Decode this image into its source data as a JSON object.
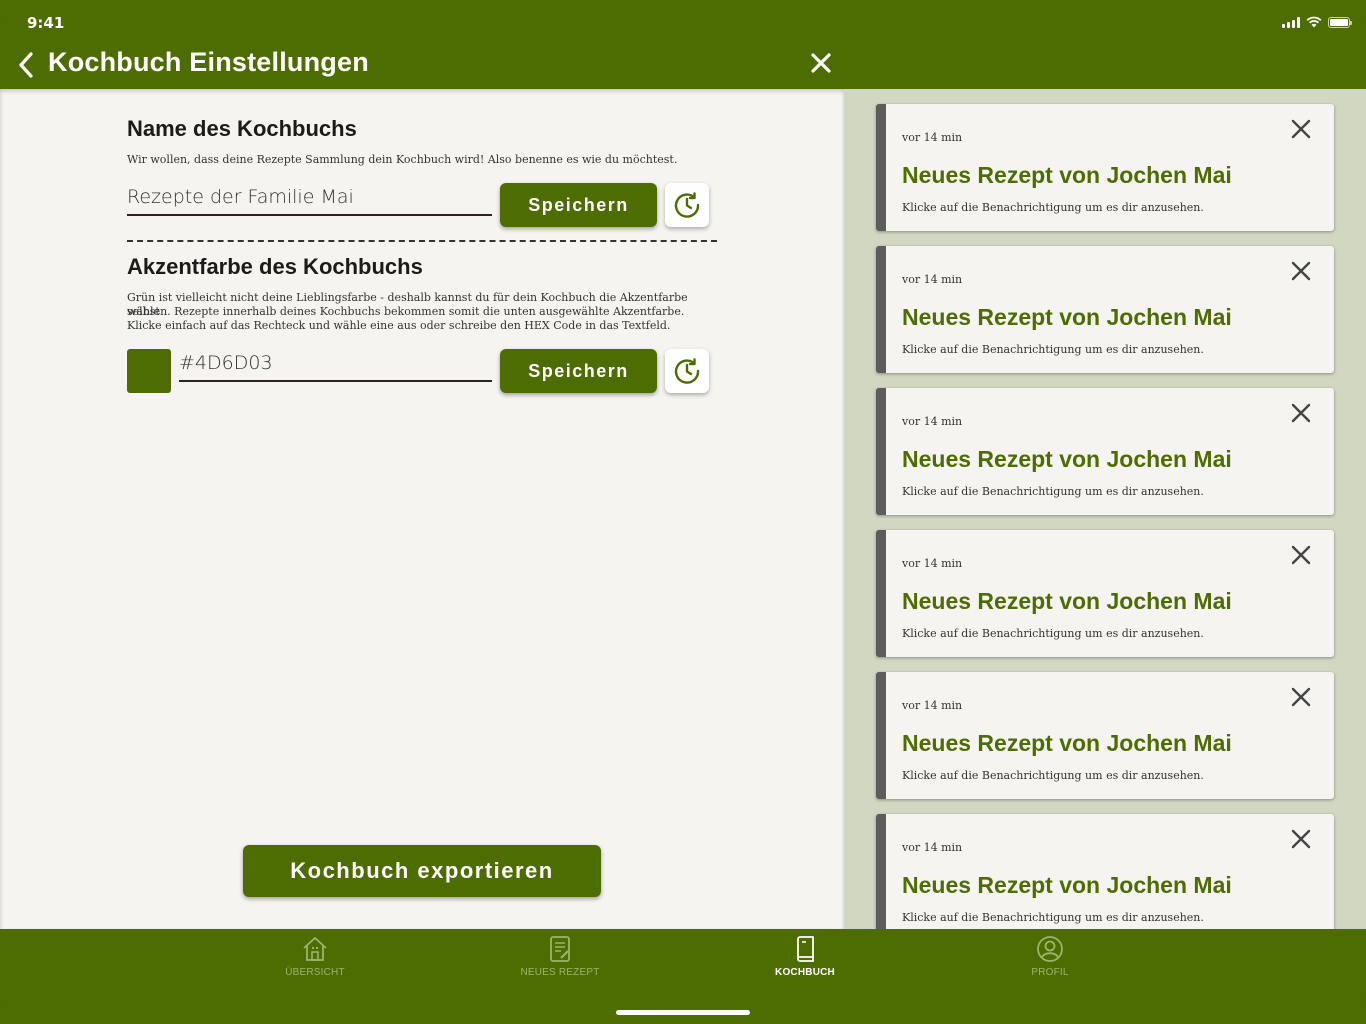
{
  "colors": {
    "accent": "#4D6D03",
    "panel_bg": "#F5F4F0",
    "notif_bg": "#D2D7C2",
    "swatch": "#4D6D03"
  },
  "status_bar": {
    "time": "9:41"
  },
  "header": {
    "title": "Kochbuch Einstellungen"
  },
  "name_section": {
    "heading": "Name des Kochbuchs",
    "description": "Wir wollen, dass deine Rezepte Sammlung dein Kochbuch wird! Also benenne es wie du möchtest.",
    "value": "Rezepte der Familie Mai",
    "save_label": "Speichern"
  },
  "color_section": {
    "heading": "Akzentfarbe des Kochbuchs",
    "description_1": "Grün ist vielleicht nicht deine Lieblingsfarbe -  deshalb kannst du für dein Kochbuch die Akzentfarbe selbst",
    "description_2": "wählen. Rezepte innerhalb deines Kochbuchs bekommen somit die unten ausgewählte Akzentfarbe.",
    "description_3": "Klicke einfach auf das Rechteck und wähle eine aus oder schreibe den HEX Code in das Textfeld.",
    "value": "#4D6D03",
    "save_label": "Speichern"
  },
  "export_label": "Kochbuch exportieren",
  "notifications": [
    {
      "time": "vor 14 min",
      "title": "Neues Rezept von Jochen Mai",
      "subtitle": "Klicke auf die Benachrichtigung um es dir anzusehen."
    },
    {
      "time": "vor 14 min",
      "title": "Neues Rezept von Jochen Mai",
      "subtitle": "Klicke auf die Benachrichtigung um es dir anzusehen."
    },
    {
      "time": "vor 14 min",
      "title": "Neues Rezept von Jochen Mai",
      "subtitle": "Klicke auf die Benachrichtigung um es dir anzusehen."
    },
    {
      "time": "vor 14 min",
      "title": "Neues Rezept von Jochen Mai",
      "subtitle": "Klicke auf die Benachrichtigung um es dir anzusehen."
    },
    {
      "time": "vor 14 min",
      "title": "Neues Rezept von Jochen Mai",
      "subtitle": "Klicke auf die Benachrichtigung um es dir anzusehen."
    },
    {
      "time": "vor 14 min",
      "title": "Neues Rezept von Jochen Mai",
      "subtitle": "Klicke auf die Benachrichtigung um es dir anzusehen."
    }
  ],
  "tabs": [
    {
      "label": "ÜBERSICHT",
      "icon": "home-icon",
      "active": false
    },
    {
      "label": "NEUES REZEPT",
      "icon": "recipe-edit-icon",
      "active": false
    },
    {
      "label": "KOCHBUCH",
      "icon": "cookbook-icon",
      "active": true
    },
    {
      "label": "PROFIL",
      "icon": "profile-icon",
      "active": false
    }
  ]
}
